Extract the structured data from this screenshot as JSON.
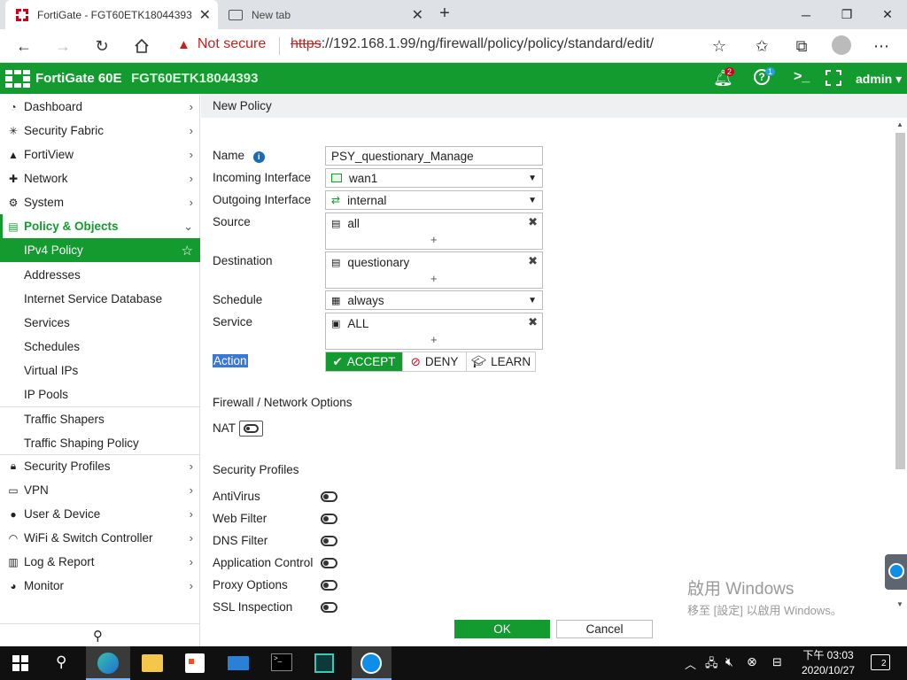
{
  "browser": {
    "tabs": [
      {
        "title": "FortiGate - FGT60ETK18044393",
        "active": true
      },
      {
        "title": "New tab",
        "active": false
      }
    ],
    "security_label": "Not secure",
    "url_scheme": "https",
    "url_rest": "://192.168.1.99/ng/firewall/policy/policy/standard/edit/"
  },
  "header": {
    "product": "FortiGate 60E",
    "hostname": "FGT60ETK18044393",
    "alerts_count": "2",
    "help_count": "1",
    "user": "admin",
    "brand_color": "#139b30"
  },
  "sidebar": {
    "items": [
      {
        "label": "Dashboard",
        "icon": "dashboard-icon"
      },
      {
        "label": "Security Fabric",
        "icon": "fabric-icon"
      },
      {
        "label": "FortiView",
        "icon": "chart-icon"
      },
      {
        "label": "Network",
        "icon": "network-icon"
      },
      {
        "label": "System",
        "icon": "gear-icon"
      },
      {
        "label": "Policy & Objects",
        "icon": "document-icon"
      },
      {
        "label": "IPv4 Policy"
      },
      {
        "label": "Addresses"
      },
      {
        "label": "Internet Service Database"
      },
      {
        "label": "Services"
      },
      {
        "label": "Schedules"
      },
      {
        "label": "Virtual IPs"
      },
      {
        "label": "IP Pools"
      },
      {
        "label": "Traffic Shapers"
      },
      {
        "label": "Traffic Shaping Policy"
      },
      {
        "label": "Security Profiles",
        "icon": "lock-icon"
      },
      {
        "label": "VPN",
        "icon": "laptop-icon"
      },
      {
        "label": "User & Device",
        "icon": "user-icon"
      },
      {
        "label": "WiFi & Switch Controller",
        "icon": "wifi-icon"
      },
      {
        "label": "Log & Report",
        "icon": "bar-chart-icon"
      },
      {
        "label": "Monitor",
        "icon": "monitor-icon"
      }
    ]
  },
  "page": {
    "title": "New Policy",
    "labels": {
      "name": "Name",
      "incoming": "Incoming Interface",
      "outgoing": "Outgoing Interface",
      "source": "Source",
      "destination": "Destination",
      "schedule": "Schedule",
      "service": "Service",
      "action": "Action"
    },
    "values": {
      "name": "PSY_questionary_Manage",
      "incoming": "wan1",
      "outgoing": "internal",
      "source": "all",
      "destination": "questionary",
      "schedule": "always",
      "service": "ALL"
    },
    "actions": {
      "accept": "ACCEPT",
      "deny": "DENY",
      "learn": "LEARN"
    },
    "firewall_section": "Firewall / Network Options",
    "nat_label": "NAT",
    "security_section": "Security Profiles",
    "profiles": [
      "AntiVirus",
      "Web Filter",
      "DNS Filter",
      "Application Control",
      "Proxy Options",
      "SSL Inspection"
    ],
    "ok": "OK",
    "cancel": "Cancel"
  },
  "watermark": {
    "line1": "啟用 Windows",
    "line2": "移至 [設定] 以啟用 Windows。"
  },
  "taskbar": {
    "time": "下午 03:03",
    "date": "2020/10/27",
    "notif_count": "2"
  }
}
